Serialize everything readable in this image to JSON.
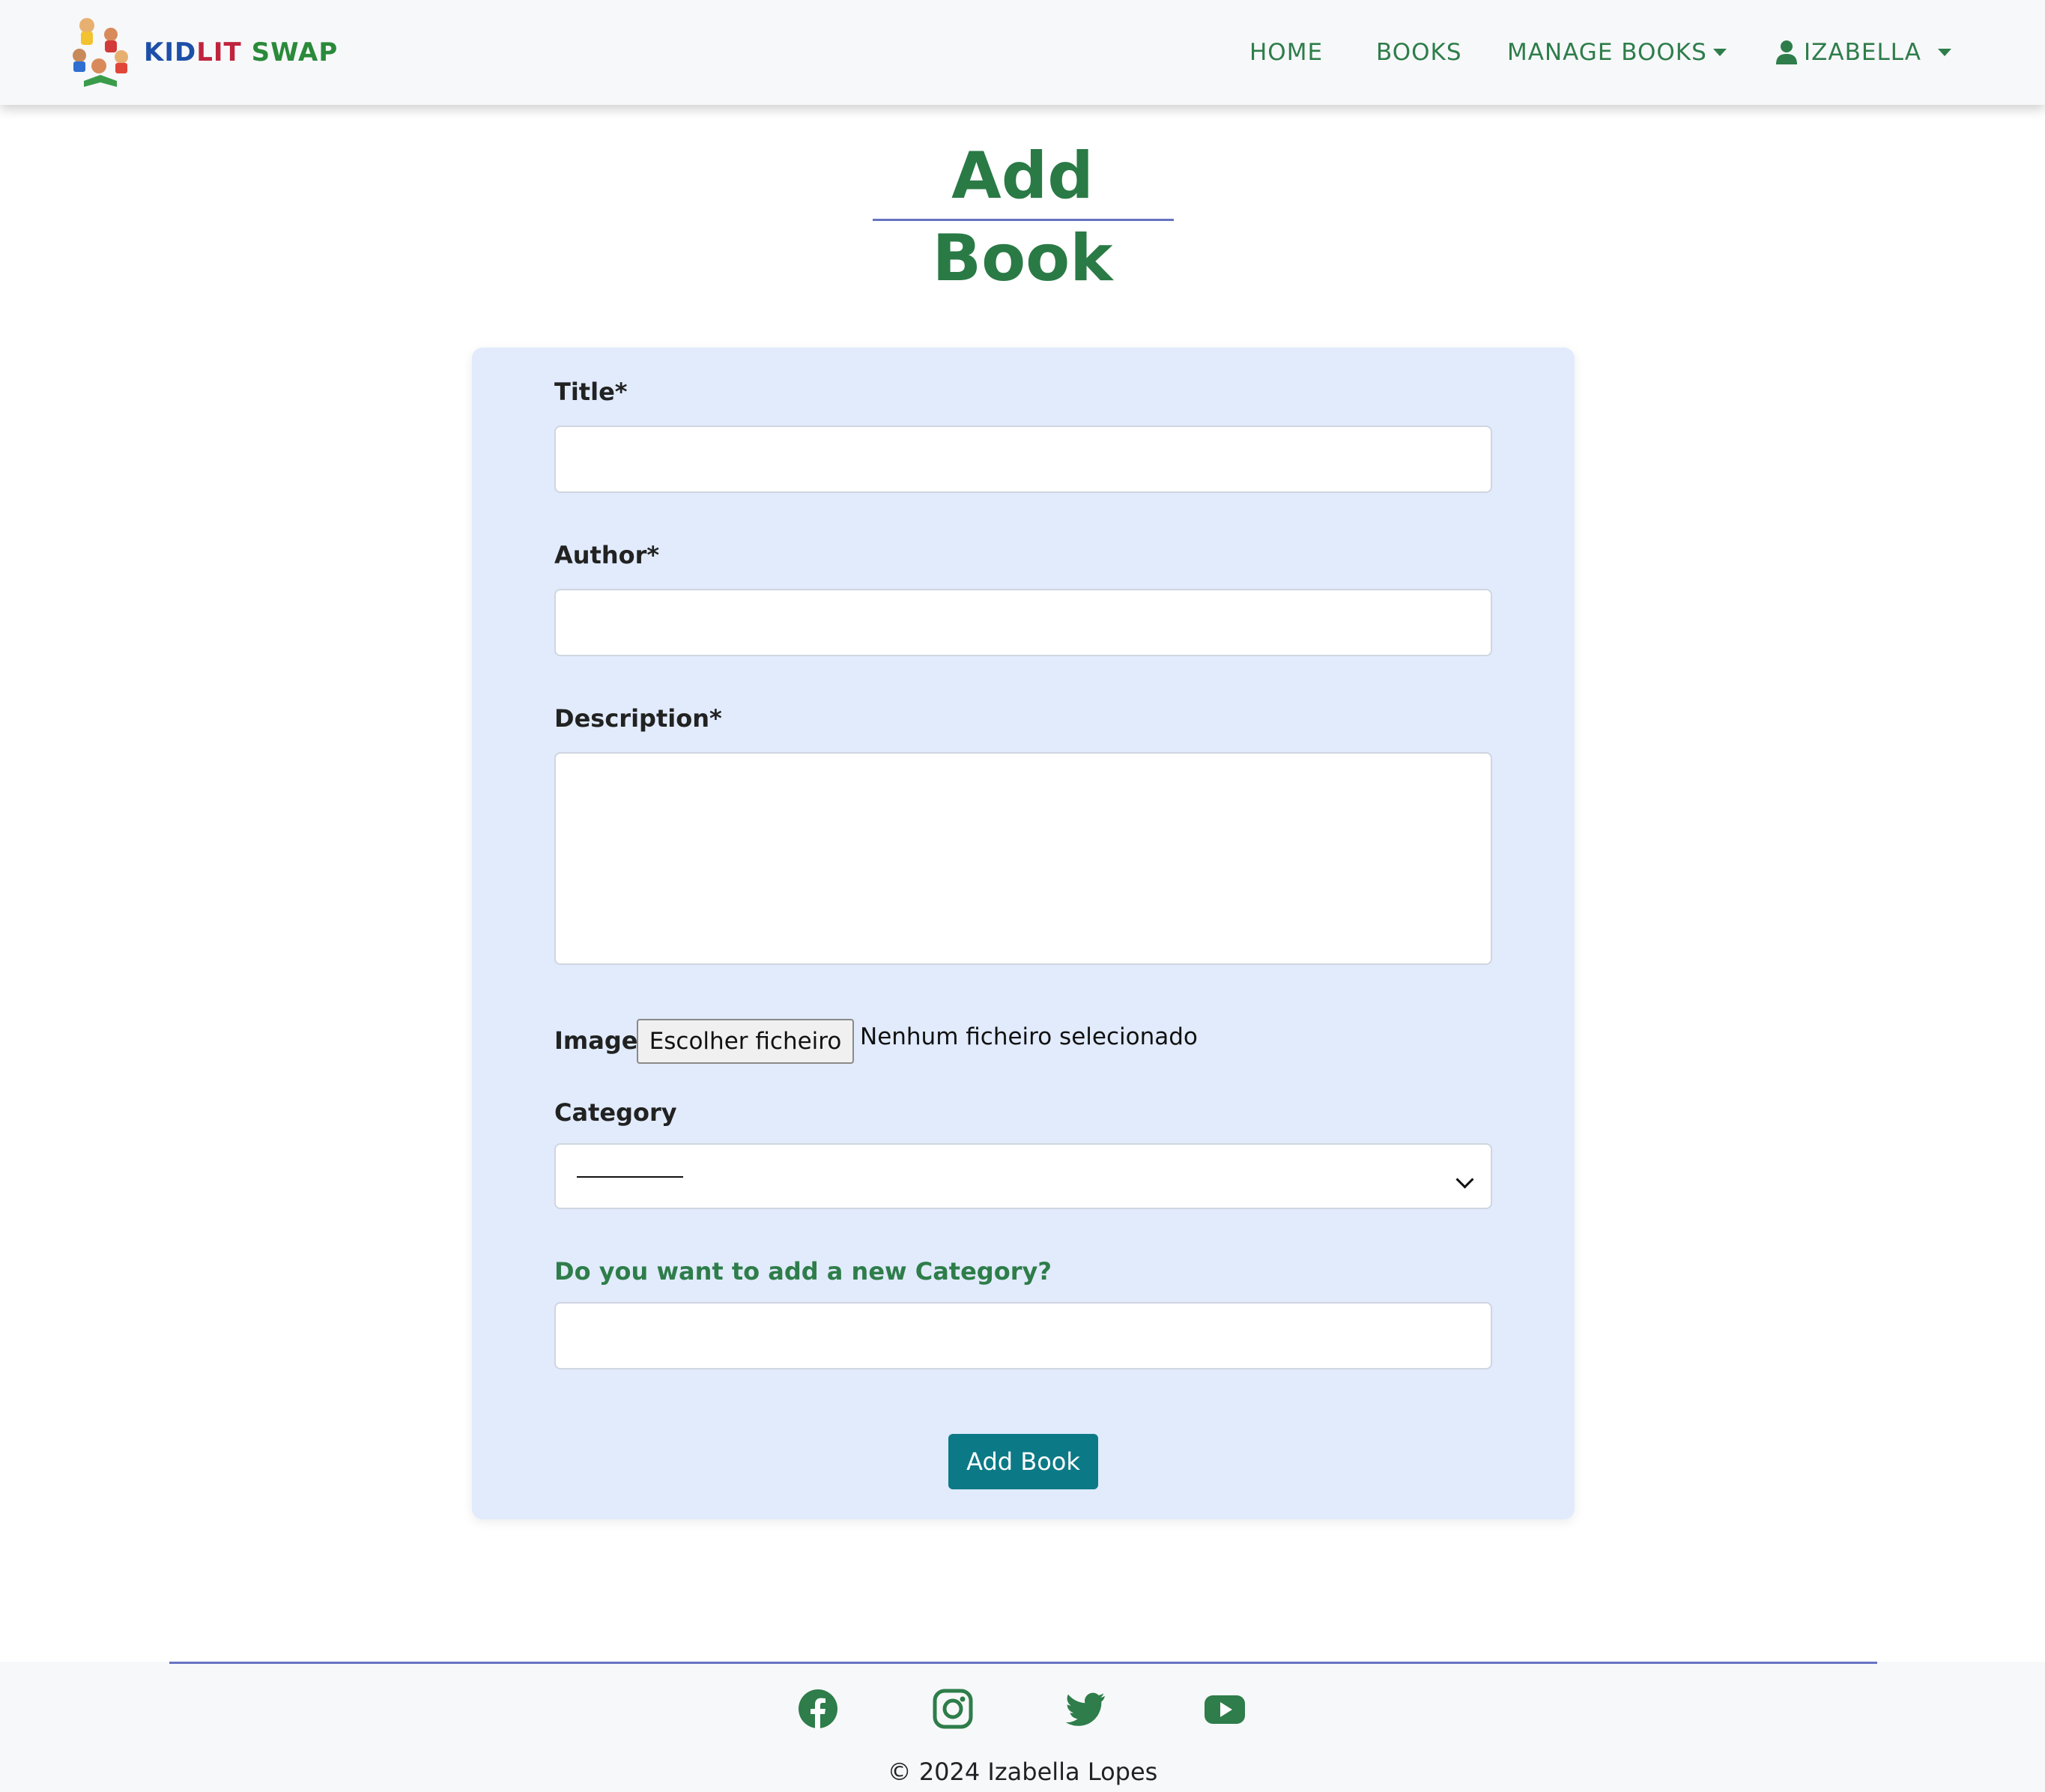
{
  "brand": {
    "name_part1": "KID",
    "name_part2": "LIT",
    "name_part3": "SWAP"
  },
  "nav": {
    "home": "HOME",
    "books": "BOOKS",
    "manage_books": "MANAGE BOOKS",
    "user": "IZABELLA"
  },
  "page": {
    "title": "Add Book"
  },
  "form": {
    "title_label": "Title*",
    "author_label": "Author*",
    "description_label": "Description*",
    "image_label": "Image",
    "file_button": "Escolher ficheiro",
    "file_status": "Nenhum ficheiro selecionado",
    "category_label": "Category",
    "category_selected": "---------",
    "new_category_label": "Do you want to add a new Category?",
    "submit": "Add Book"
  },
  "footer": {
    "social": [
      "facebook-icon",
      "instagram-icon",
      "twitter-icon",
      "youtube-icon"
    ],
    "copyright": "© 2024 Izabella Lopes"
  },
  "colors": {
    "accent_green": "#2e7d4a",
    "card_bg": "#e1ebfc",
    "button_teal": "#0c7a86",
    "divider": "#6673c4"
  }
}
